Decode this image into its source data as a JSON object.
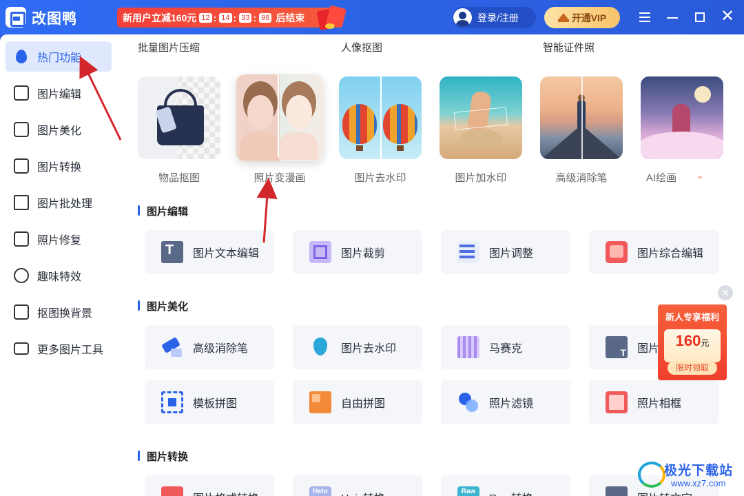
{
  "app": {
    "name": "改图鸭"
  },
  "promo_banner": {
    "text": "新用户立减160元",
    "countdown": [
      "12",
      "14",
      "33",
      "98"
    ],
    "end_text": "后结束"
  },
  "header": {
    "login_label": "登录/注册",
    "vip_label": "开通VIP"
  },
  "sidebar": {
    "items": [
      {
        "label": "热门功能",
        "icon": "flame-icon",
        "active": true
      },
      {
        "label": "图片编辑",
        "icon": "image-edit-icon"
      },
      {
        "label": "图片美化",
        "icon": "image-beautify-icon"
      },
      {
        "label": "图片转换",
        "icon": "image-convert-icon"
      },
      {
        "label": "图片批处理",
        "icon": "batch-icon"
      },
      {
        "label": "照片修复",
        "icon": "photo-repair-icon"
      },
      {
        "label": "趣味特效",
        "icon": "sparkle-icon"
      },
      {
        "label": "抠图换背景",
        "icon": "cutout-icon"
      },
      {
        "label": "更多图片工具",
        "icon": "toolbox-icon"
      }
    ]
  },
  "hot": {
    "categories": [
      "批量图片压缩",
      "人像抠图",
      "智能证件照"
    ],
    "features": [
      {
        "label": "物品抠图"
      },
      {
        "label": "照片变漫画"
      },
      {
        "label": "图片去水印"
      },
      {
        "label": "图片加水印"
      },
      {
        "label": "高级消除笔"
      },
      {
        "label": "AI绘画"
      }
    ]
  },
  "sections": {
    "edit": {
      "title": "图片编辑",
      "items": [
        "图片文本编辑",
        "图片裁剪",
        "图片调整",
        "图片综合编辑"
      ]
    },
    "beautify": {
      "title": "图片美化",
      "items": [
        "高级消除笔",
        "图片去水印",
        "马赛克",
        "图片",
        "模板拼图",
        "自由拼图",
        "照片滤镜",
        "照片相框"
      ]
    },
    "convert": {
      "title": "图片转换",
      "items": [
        "图片格式转换",
        "Heic转换",
        "Raw转换",
        "图片转文字"
      ],
      "icon_texts": [
        "Helo",
        "Raw"
      ]
    }
  },
  "promo_popup": {
    "title": "新人专享福利",
    "amount": "160",
    "unit": "元",
    "button": "限时领取"
  },
  "watermark": {
    "name": "极光下载站",
    "url": "www.xz7.com"
  }
}
